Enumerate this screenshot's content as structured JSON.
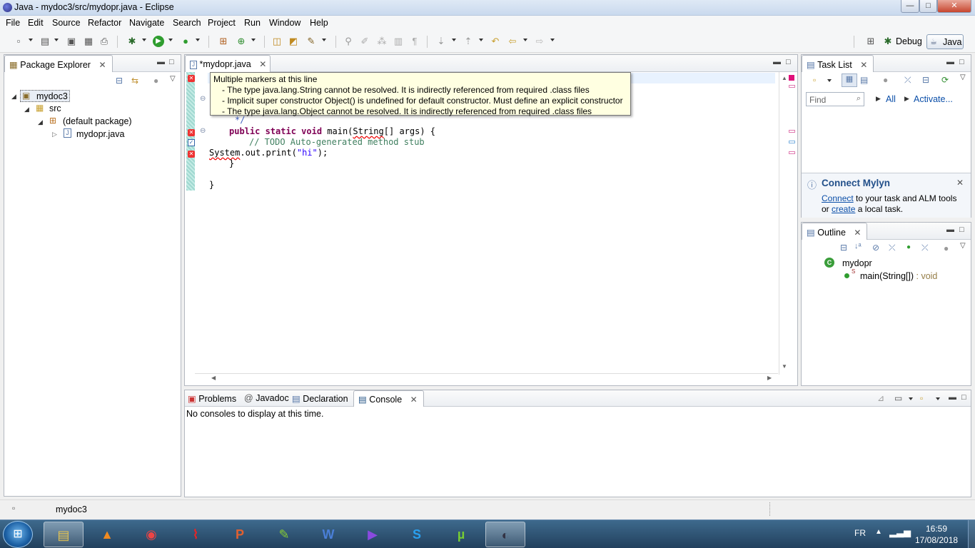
{
  "window": {
    "title": "Java - mydoc3/src/mydopr.java - Eclipse",
    "min": "—",
    "max": "□",
    "close": "✕"
  },
  "menu": [
    "File",
    "Edit",
    "Source",
    "Refactor",
    "Navigate",
    "Search",
    "Project",
    "Run",
    "Window",
    "Help"
  ],
  "perspectives": {
    "debug": "Debug",
    "java": "Java"
  },
  "package_explorer": {
    "title": "Package Explorer",
    "tree": {
      "project": "mydoc3",
      "src": "src",
      "package": "(default package)",
      "file": "mydopr.java"
    }
  },
  "editor": {
    "tab": "*mydopr.java",
    "code": {
      "comment_end": "*/",
      "main_decl_kw": "public static void",
      "main_decl_name": " main(",
      "main_decl_type": "String",
      "main_decl_rest": "[] args) {",
      "todo": "// TODO Auto-generated method stub",
      "sys_err": "System",
      "sys_rest": ".out.print(",
      "sys_str": "\"hi\"",
      "sys_end": ");",
      "brace_close_inner": "}",
      "brace_close_outer": "}"
    },
    "tooltip": {
      "header": "Multiple markers at this line",
      "lines": [
        "- The type java.lang.String cannot be resolved. It is indirectly referenced from required .class files",
        "- Implicit super constructor Object() is undefined for default constructor. Must define an explicit constructor",
        "- The type java.lang.Object cannot be resolved. It is indirectly referenced from required .class files"
      ]
    }
  },
  "task_list": {
    "title": "Task List",
    "find_placeholder": "Find",
    "all": "All",
    "activate": "Activate...",
    "mylyn_title": "Connect Mylyn",
    "mylyn_connect": "Connect",
    "mylyn_text1": " to your task and ALM tools",
    "mylyn_or": "or ",
    "mylyn_create": "create",
    "mylyn_text2": " a local task."
  },
  "outline": {
    "title": "Outline",
    "class_name": "mydopr",
    "method": "main(String[])",
    "return": " : void"
  },
  "bottom": {
    "tabs": [
      "Problems",
      "Javadoc",
      "Declaration",
      "Console"
    ],
    "active": "Console",
    "message": "No consoles to display at this time."
  },
  "status": {
    "selected": "mydoc3"
  },
  "taskbar": {
    "lang": "FR",
    "time": "16:59",
    "date": "17/08/2018"
  },
  "colors": {
    "accent": "#0a4ea8",
    "error": "#e00000",
    "keyword": "#7f0055",
    "comment": "#3f7f5f",
    "string": "#2a00ff"
  }
}
